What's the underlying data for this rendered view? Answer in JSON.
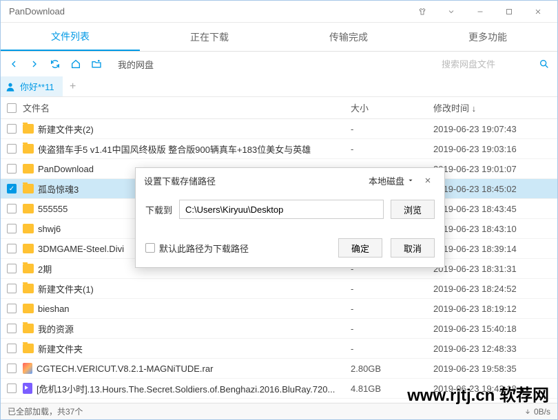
{
  "title": "PanDownload",
  "tabs": [
    "文件列表",
    "正在下载",
    "传输完成",
    "更多功能"
  ],
  "active_tab": 0,
  "breadcrumb": "我的网盘",
  "search_placeholder": "搜索网盘文件",
  "user_tab": "你好**11",
  "columns": {
    "name": "文件名",
    "size": "大小",
    "date": "修改时间 ↓"
  },
  "files": [
    {
      "checked": false,
      "type": "folder",
      "name": "新建文件夹(2)",
      "size": "-",
      "date": "2019-06-23 19:07:43"
    },
    {
      "checked": false,
      "type": "folder",
      "name": "侠盗猎车手5 v1.41中国风终极版 整合版900辆真车+183位美女与英雄",
      "size": "-",
      "date": "2019-06-23 19:03:16"
    },
    {
      "checked": false,
      "type": "folder",
      "name": "PanDownload",
      "size": "-",
      "date": "2019-06-23 19:01:07"
    },
    {
      "checked": true,
      "type": "folder",
      "name": "孤岛惊魂3",
      "size": "-",
      "date": "2019-06-23 18:45:02"
    },
    {
      "checked": false,
      "type": "folder",
      "name": "555555",
      "size": "-",
      "date": "2019-06-23 18:43:45"
    },
    {
      "checked": false,
      "type": "folder",
      "name": "shwj6",
      "size": "-",
      "date": "2019-06-23 18:43:10"
    },
    {
      "checked": false,
      "type": "folder",
      "name": "3DMGAME-Steel.Divi",
      "size": "-",
      "date": "2019-06-23 18:39:14"
    },
    {
      "checked": false,
      "type": "folder",
      "name": "2期",
      "size": "-",
      "date": "2019-06-23 18:31:31"
    },
    {
      "checked": false,
      "type": "folder",
      "name": "新建文件夹(1)",
      "size": "-",
      "date": "2019-06-23 18:24:52"
    },
    {
      "checked": false,
      "type": "folder",
      "name": "bieshan",
      "size": "-",
      "date": "2019-06-23 18:19:12"
    },
    {
      "checked": false,
      "type": "folder",
      "name": "我的资源",
      "size": "-",
      "date": "2019-06-23 15:40:18"
    },
    {
      "checked": false,
      "type": "folder",
      "name": "新建文件夹",
      "size": "-",
      "date": "2019-06-23 12:48:33"
    },
    {
      "checked": false,
      "type": "rar",
      "name": "CGTECH.VERICUT.V8.2.1-MAGNiTUDE.rar",
      "size": "2.80GB",
      "date": "2019-06-23 19:58:35"
    },
    {
      "checked": false,
      "type": "video",
      "name": "[危机13小时].13.Hours.The.Secret.Soldiers.of.Benghazi.2016.BluRay.720...",
      "size": "4.81GB",
      "date": "2019-06-23 19:42:18"
    }
  ],
  "status_left": "已全部加载，共37个",
  "status_speed": "0B/s",
  "watermark": "www.rjtj.cn 软荐网",
  "dialog": {
    "title": "设置下载存储路径",
    "disk_label": "本地磁盘",
    "download_to": "下载到",
    "path_value": "C:\\Users\\Kiryuu\\Desktop",
    "browse": "浏览",
    "default_path_label": "默认此路径为下载路径",
    "ok": "确定",
    "cancel": "取消"
  }
}
